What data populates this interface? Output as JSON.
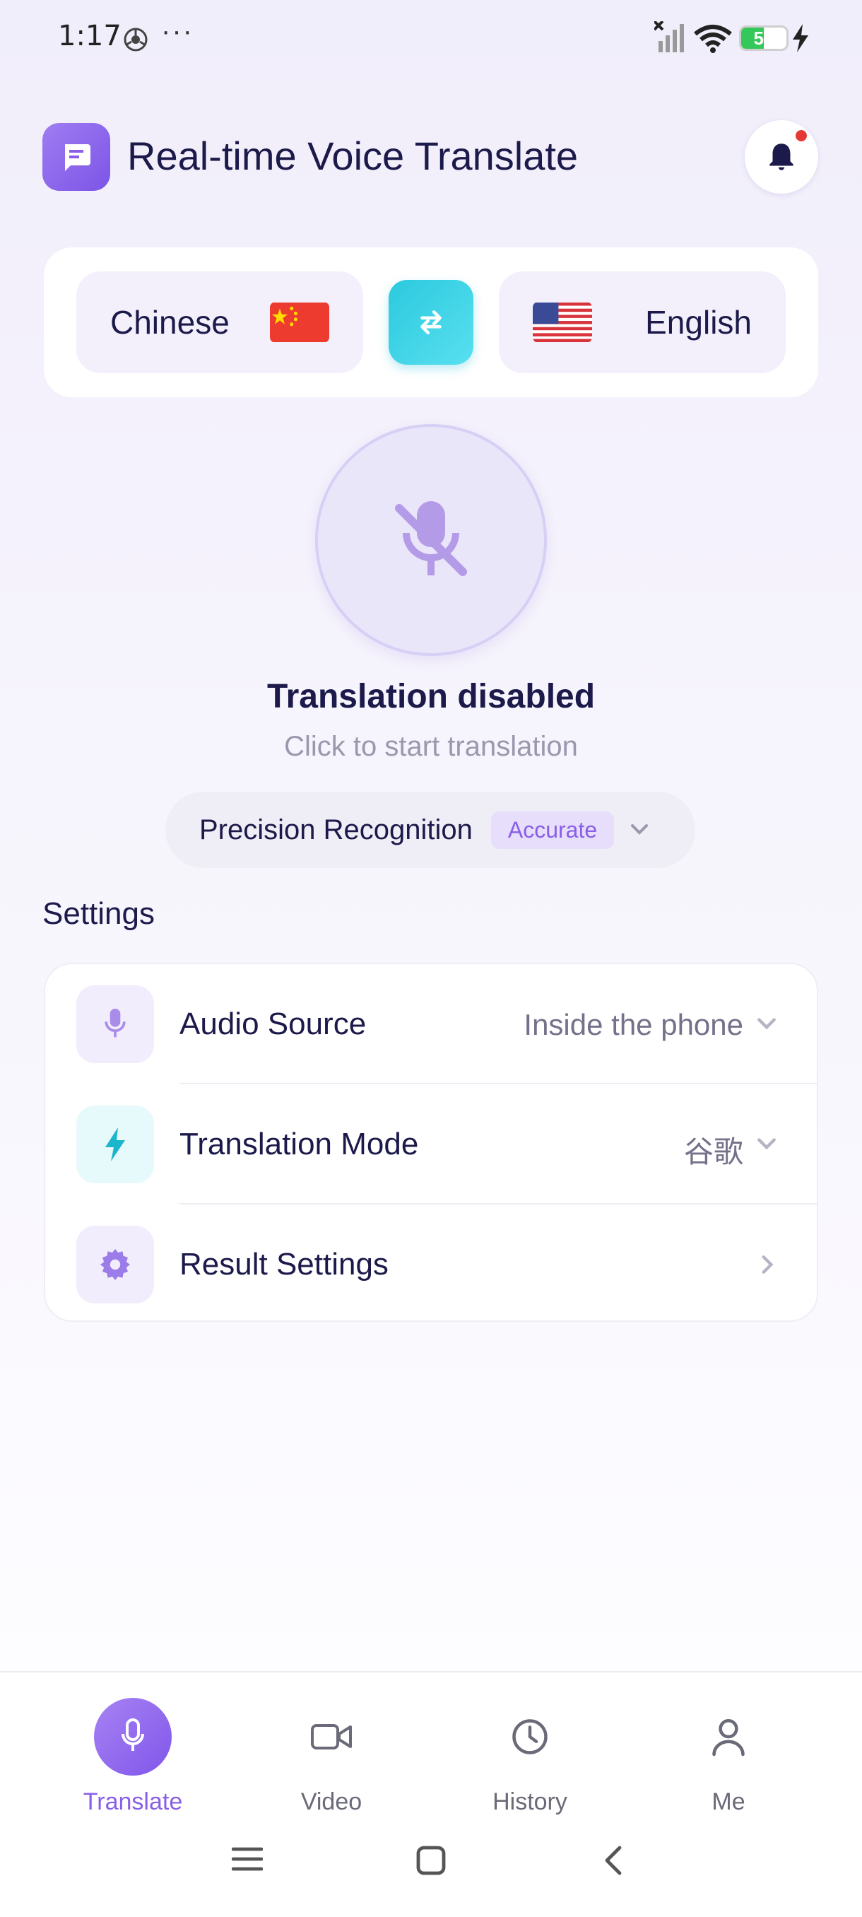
{
  "status_bar": {
    "time": "1:17",
    "dots": "···",
    "battery_level": "50",
    "battery_fraction": 0.5
  },
  "header": {
    "title": "Real-time Voice Translate"
  },
  "languages": {
    "source": "Chinese",
    "target": "English"
  },
  "translation_status": {
    "title": "Translation disabled",
    "subtitle": "Click to start translation"
  },
  "precision": {
    "label": "Precision Recognition",
    "badge": "Accurate"
  },
  "settings": {
    "heading": "Settings",
    "rows": [
      {
        "label": "Audio Source",
        "value": "Inside the phone",
        "icon": "microphone-icon"
      },
      {
        "label": "Translation Mode",
        "value": "谷歌",
        "icon": "lightning-icon"
      },
      {
        "label": "Result Settings",
        "value": "",
        "icon": "gear-icon"
      }
    ]
  },
  "nav": {
    "items": [
      {
        "label": "Translate",
        "icon": "microphone-icon",
        "active": true
      },
      {
        "label": "Video",
        "icon": "video-camera-icon",
        "active": false
      },
      {
        "label": "History",
        "icon": "clock-icon",
        "active": false
      },
      {
        "label": "Me",
        "icon": "person-icon",
        "active": false
      }
    ]
  },
  "colors": {
    "accent": "#8a5fe8",
    "swap": "#2cc9de",
    "battery": "#34c759",
    "notification_dot": "#e53935"
  }
}
